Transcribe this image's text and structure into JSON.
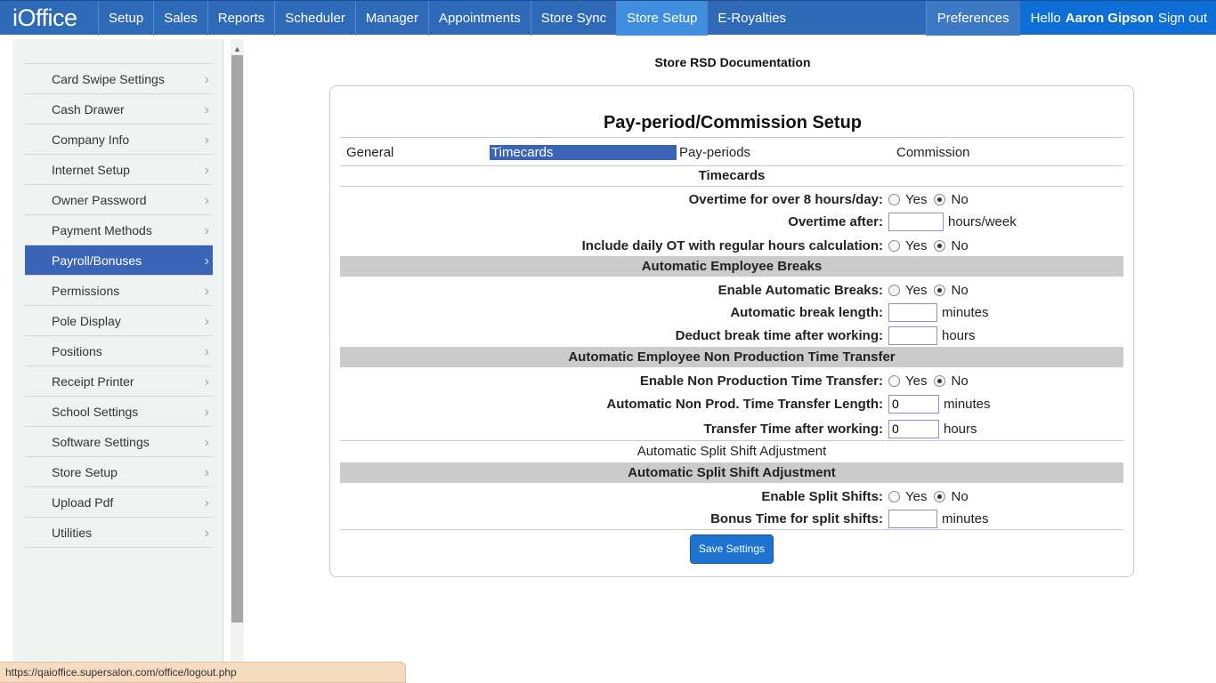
{
  "header": {
    "logo": "iOffice",
    "nav": [
      "Setup",
      "Sales",
      "Reports",
      "Scheduler",
      "Manager",
      "Appointments",
      "Store Sync",
      "Store Setup",
      "E-Royalties"
    ],
    "active_nav": "Store Setup",
    "preferences": "Preferences",
    "hello_prefix": "Hello",
    "user_name": "Aaron Gipson",
    "sign_out": "Sign out"
  },
  "sidebar": {
    "items": [
      {
        "label": "Card Swipe Settings"
      },
      {
        "label": "Cash Drawer"
      },
      {
        "label": "Company Info"
      },
      {
        "label": "Internet Setup"
      },
      {
        "label": "Owner Password"
      },
      {
        "label": "Payment Methods"
      },
      {
        "label": "Payroll/Bonuses",
        "active": true
      },
      {
        "label": "Permissions"
      },
      {
        "label": "Pole Display"
      },
      {
        "label": "Positions"
      },
      {
        "label": "Receipt Printer"
      },
      {
        "label": "School Settings"
      },
      {
        "label": "Software Settings"
      },
      {
        "label": "Store Setup"
      },
      {
        "label": "Upload Pdf"
      },
      {
        "label": "Utilities"
      }
    ],
    "chevron": "›"
  },
  "main": {
    "doc_title": "Store RSD Documentation",
    "panel_title": "Pay-period/Commission Setup",
    "tabs": {
      "general": "General",
      "timecards": "Timecards",
      "pay_periods": "Pay-periods",
      "commission": "Commission"
    },
    "timecards_heading": "Timecards",
    "yes": "Yes",
    "no": "No",
    "overtime_day_label": "Overtime for over 8 hours/day:",
    "overtime_after_label": "Overtime after:",
    "overtime_after_value": "",
    "overtime_after_unit": "hours/week",
    "daily_ot_label": "Include daily OT with regular hours calculation:",
    "breaks_heading": "Automatic Employee Breaks",
    "enable_breaks_label": "Enable Automatic Breaks:",
    "break_length_label": "Automatic break length:",
    "break_length_value": "",
    "break_length_unit": "minutes",
    "deduct_break_label": "Deduct break time after working:",
    "deduct_break_value": "",
    "deduct_break_unit": "hours",
    "npt_heading": "Automatic Employee Non Production Time Transfer",
    "enable_npt_label": "Enable Non Production Time Transfer:",
    "npt_length_label": "Automatic Non Prod. Time Transfer Length:",
    "npt_length_value": "0",
    "npt_length_unit": "minutes",
    "transfer_after_label": "Transfer Time after working:",
    "transfer_after_value": "0",
    "transfer_after_unit": "hours",
    "split_plain_heading": "Automatic Split Shift Adjustment",
    "split_heading": "Automatic Split Shift Adjustment",
    "enable_split_label": "Enable Split Shifts:",
    "bonus_split_label": "Bonus Time for split shifts:",
    "bonus_split_value": "",
    "bonus_split_unit": "minutes",
    "save_button": "Save Settings"
  },
  "status_url": "https://qaioffice.supersalon.com/office/logout.php"
}
